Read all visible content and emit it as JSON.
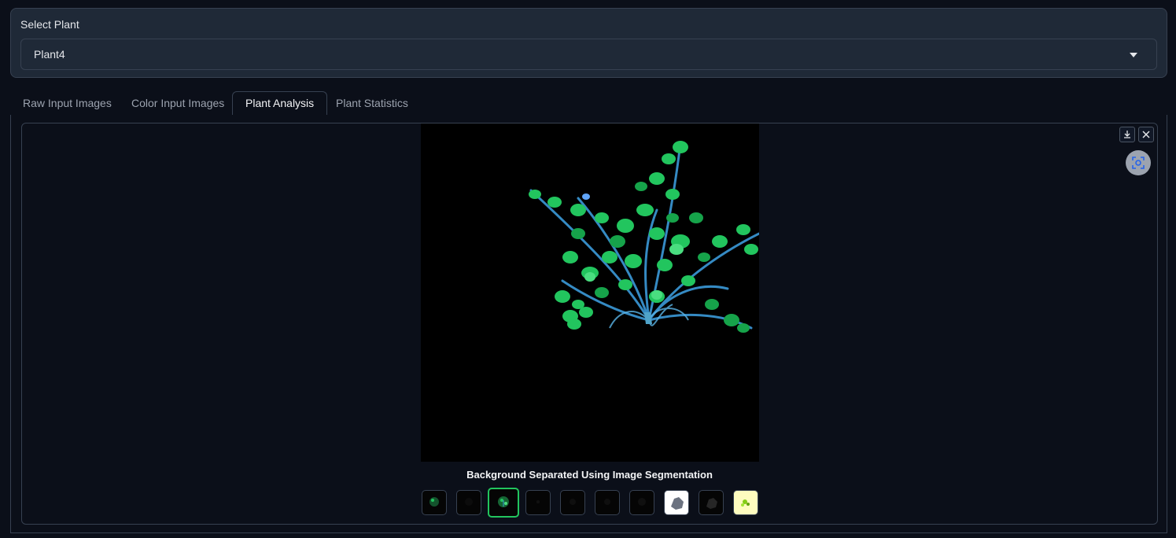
{
  "select_plant": {
    "label": "Select Plant",
    "value": "Plant4"
  },
  "tabs": [
    {
      "label": "Raw Input Images",
      "active": false
    },
    {
      "label": "Color Input Images",
      "active": false
    },
    {
      "label": "Plant Analysis",
      "active": true
    },
    {
      "label": "Plant Statistics",
      "active": false
    }
  ],
  "gallery": {
    "caption": "Background Separated Using Image Segmentation",
    "selected_index": 2,
    "thumbnail_count": 10,
    "icons": {
      "download": "download-icon",
      "close": "close-icon",
      "fullscreen": "fullscreen-icon"
    }
  },
  "colors": {
    "background": "#0b0f19",
    "panel": "#1f2937",
    "border": "#374151",
    "selected_thumb": "#22c55e",
    "leaf_green": "#2ea043",
    "stem_blue": "#3b9ad9"
  }
}
